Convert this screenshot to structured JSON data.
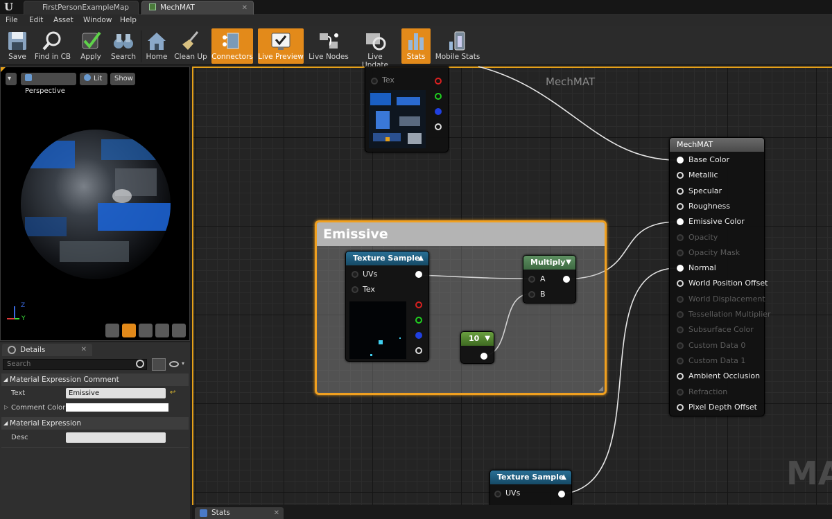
{
  "tabs": [
    {
      "label": "FirstPersonExampleMap"
    },
    {
      "label": "MechMAT"
    }
  ],
  "menu": [
    "File",
    "Edit",
    "Asset",
    "Window",
    "Help"
  ],
  "toolbar": [
    {
      "label": "Save",
      "icon": "floppy-icon"
    },
    {
      "label": "Find in CB",
      "icon": "magnifier-icon"
    },
    {
      "label": "Apply",
      "icon": "checkmark-icon"
    },
    {
      "label": "Search",
      "icon": "binoculars-icon"
    },
    {
      "label": "Home",
      "icon": "house-icon"
    },
    {
      "label": "Clean Up",
      "icon": "broom-icon"
    },
    {
      "label": "Connectors",
      "icon": "connectors-icon",
      "active": true
    },
    {
      "label": "Live Preview",
      "icon": "monitor-icon",
      "active": true
    },
    {
      "label": "Live Nodes",
      "icon": "nodes-icon"
    },
    {
      "label": "Live Update",
      "icon": "refresh-icon"
    },
    {
      "label": "Stats",
      "icon": "stats-icon",
      "active": true
    },
    {
      "label": "Mobile Stats",
      "icon": "mobile-stats-icon"
    }
  ],
  "viewport": {
    "perspective": "Perspective",
    "lit": "Lit",
    "show": "Show",
    "axis_z": "Z",
    "axis_y": "Y"
  },
  "details": {
    "tab": "Details",
    "search_placeholder": "Search",
    "section1": "Material Expression Comment",
    "text_label": "Text",
    "text_value": "Emissive",
    "color_label": "Comment Color",
    "section2": "Material Expression",
    "desc_label": "Desc",
    "desc_value": ""
  },
  "graph": {
    "title": "MechMAT",
    "watermark": "MA",
    "top_node": {
      "tex": "Tex"
    },
    "comment": {
      "title": "Emissive"
    },
    "texture_node": {
      "title": "Texture Sample",
      "uvs": "UVs",
      "tex": "Tex"
    },
    "multiply_node": {
      "title": "Multiply",
      "a": "A",
      "b": "B"
    },
    "constant_node": {
      "value": "10"
    },
    "bottom_node": {
      "title": "Texture Sample",
      "uvs": "UVs"
    },
    "result": {
      "title": "MechMAT",
      "pins": [
        {
          "label": "Base Color",
          "on": true,
          "filled": true
        },
        {
          "label": "Metallic",
          "on": true
        },
        {
          "label": "Specular",
          "on": true
        },
        {
          "label": "Roughness",
          "on": true
        },
        {
          "label": "Emissive Color",
          "on": true,
          "filled": true
        },
        {
          "label": "Opacity",
          "on": false
        },
        {
          "label": "Opacity Mask",
          "on": false
        },
        {
          "label": "Normal",
          "on": true,
          "filled": true
        },
        {
          "label": "World Position Offset",
          "on": true
        },
        {
          "label": "World Displacement",
          "on": false
        },
        {
          "label": "Tessellation Multiplier",
          "on": false
        },
        {
          "label": "Subsurface Color",
          "on": false
        },
        {
          "label": "Custom Data 0",
          "on": false
        },
        {
          "label": "Custom Data 1",
          "on": false
        },
        {
          "label": "Ambient Occlusion",
          "on": true
        },
        {
          "label": "Refraction",
          "on": false
        },
        {
          "label": "Pixel Depth Offset",
          "on": true
        }
      ]
    }
  },
  "bottom_tab": {
    "label": "Stats"
  },
  "colors": {
    "accent": "#e38a1a",
    "comment_border": "#f0a020",
    "texture_header": "#1e5a78",
    "multiply_header": "#4e7a52",
    "constant_header": "#5a8a3a"
  }
}
